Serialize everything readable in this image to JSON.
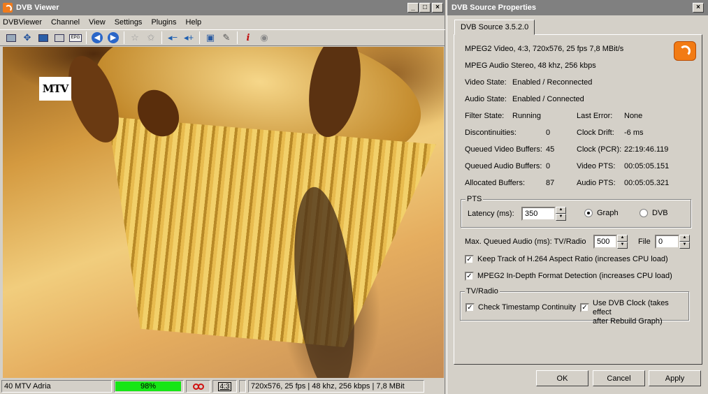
{
  "viewer": {
    "title": "DVB Viewer",
    "controls": {
      "minimize": "_",
      "maximize": "□",
      "close": "×"
    },
    "menu": [
      "DVBViewer",
      "Channel",
      "View",
      "Settings",
      "Plugins",
      "Help"
    ],
    "toolbar_icons": [
      "screen-icon",
      "fullscreen-icon",
      "teletext-icon",
      "snapshot-icon",
      "epg-icon",
      "back-icon",
      "forward-icon",
      "favorite-add-icon",
      "favorite-icon",
      "volume-down-icon",
      "volume-up-icon",
      "record-icon",
      "tools-icon",
      "info-icon",
      "stop-icon"
    ],
    "epg_label": "EPG",
    "logo_text": "MTV",
    "status": {
      "channel": "40 MTV Adria",
      "signal": "98%",
      "signal_value": 0.98,
      "aspect": "4:3",
      "stream_info": "720x576, 25 fps | 48 khz, 256 kbps | 7,8 MBit"
    }
  },
  "props": {
    "title": "DVB Source Properties",
    "close": "×",
    "tab": "DVB Source 3.5.2.0",
    "video_info": "MPEG2 Video, 4:3, 720x576, 25 fps  7,8 MBit/s",
    "audio_info": "MPEG Audio Stereo, 48 khz, 256 kbps",
    "video_state_label": "Video State:",
    "video_state_value": "Enabled / Reconnected",
    "audio_state_label": "Audio State:",
    "audio_state_value": "Enabled / Connected",
    "stats_left": [
      {
        "label": "Filter State:",
        "value": "Running"
      },
      {
        "label": "Discontinuities:",
        "value": "0"
      },
      {
        "label": "Queued Video Buffers:",
        "value": "45"
      },
      {
        "label": "Queued Audio Buffers:",
        "value": "0"
      },
      {
        "label": "Allocated Buffers:",
        "value": "87"
      }
    ],
    "stats_right": [
      {
        "label": "Last Error:",
        "value": "None"
      },
      {
        "label": "Clock Drift:",
        "value": "-6 ms"
      },
      {
        "label": "Clock (PCR):",
        "value": "22:19:46.119"
      },
      {
        "label": "Video PTS:",
        "value": "00:05:05.151"
      },
      {
        "label": "Audio PTS:",
        "value": "00:05:05.321"
      }
    ],
    "pts_group": {
      "legend": "PTS",
      "latency_label": "Latency (ms):",
      "latency_value": "350",
      "radio_graph": "Graph",
      "radio_dvb": "DVB",
      "selected": "Graph"
    },
    "max_queued_label": "Max. Queued Audio (ms): TV/Radio",
    "max_queued_value": "500",
    "file_label": "File",
    "file_value": "0",
    "check_h264": "Keep Track of H.264 Aspect Ratio (increases CPU load)",
    "check_mpeg2": "MPEG2 In-Depth Format Detection (increases CPU load)",
    "tvradio_group": {
      "legend": "TV/Radio",
      "check_timestamp": "Check Timestamp Continuity",
      "check_dvbclock_1": "Use DVB Clock (takes effect",
      "check_dvbclock_2": "after Rebuild Graph)"
    },
    "buttons": {
      "ok": "OK",
      "cancel": "Cancel",
      "apply": "Apply"
    }
  }
}
